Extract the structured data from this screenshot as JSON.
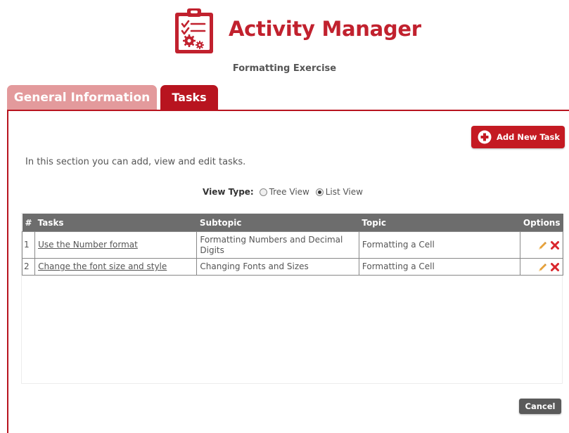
{
  "header": {
    "app_title": "Activity Manager",
    "subtitle": "Formatting Exercise",
    "logo_icon": "clipboard-gear-icon"
  },
  "tabs": [
    {
      "label": "General Information",
      "active": false
    },
    {
      "label": "Tasks",
      "active": true
    }
  ],
  "toolbar": {
    "add_label": "Add New Task"
  },
  "intro": "In this section you can add, view and edit tasks.",
  "view_type": {
    "label": "View Type:",
    "options": [
      "Tree View",
      "List View"
    ],
    "selected": "List View"
  },
  "table": {
    "headers": [
      "#",
      "Tasks",
      "Subtopic",
      "Topic",
      "Options"
    ],
    "rows": [
      {
        "num": "1",
        "task": "Use the Number format",
        "subtopic": "Formatting Numbers and Decimal Digits",
        "topic": "Formatting a Cell"
      },
      {
        "num": "2",
        "task": "Change the font size and style",
        "subtopic": "Changing Fonts and Sizes",
        "topic": "Formatting a Cell"
      }
    ],
    "option_icons": [
      "pencil-icon",
      "delete-x-icon"
    ]
  },
  "footer": {
    "cancel_label": "Cancel"
  },
  "colors": {
    "brand_red": "#c1212e",
    "tab_active": "#b8141f",
    "tab_inactive": "#e39a9c",
    "header_gray": "#6d6d6d",
    "edit_orange": "#e8a23a"
  }
}
